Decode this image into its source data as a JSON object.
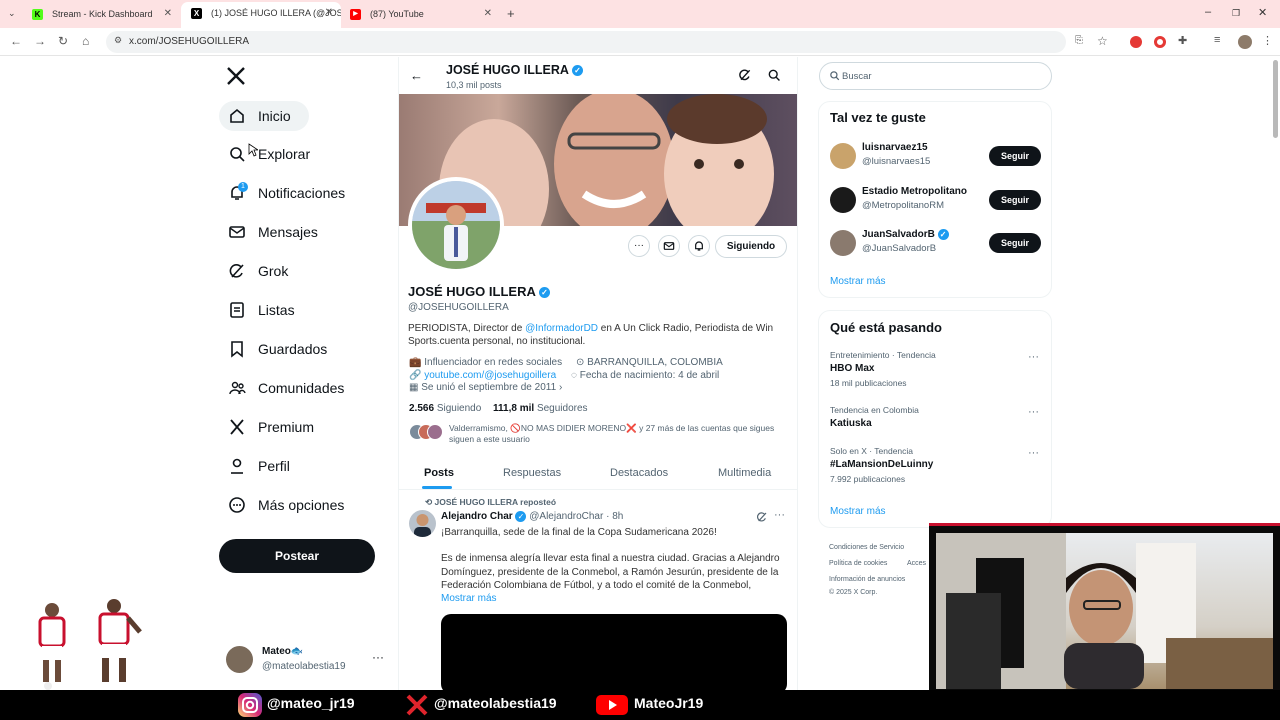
{
  "browser": {
    "tabs": [
      {
        "title": "Stream - Kick Dashboard",
        "favicon": "K"
      },
      {
        "title": "(1) JOSÉ HUGO ILLERA (@JOSE",
        "favicon": "X"
      },
      {
        "title": "(87) YouTube",
        "favicon": "▶"
      }
    ],
    "url": "x.com/JOSEHUGOILLERA"
  },
  "sidebar": {
    "items": [
      {
        "label": "Inicio",
        "icon": "home-icon"
      },
      {
        "label": "Explorar",
        "icon": "search-icon"
      },
      {
        "label": "Notificaciones",
        "icon": "bell-icon",
        "badge": "1"
      },
      {
        "label": "Mensajes",
        "icon": "mail-icon"
      },
      {
        "label": "Grok",
        "icon": "grok-icon"
      },
      {
        "label": "Listas",
        "icon": "list-icon"
      },
      {
        "label": "Guardados",
        "icon": "bookmark-icon"
      },
      {
        "label": "Comunidades",
        "icon": "communities-icon"
      },
      {
        "label": "Premium",
        "icon": "x-logo-icon"
      },
      {
        "label": "Perfil",
        "icon": "person-icon"
      },
      {
        "label": "Más opciones",
        "icon": "more-circle-icon"
      }
    ],
    "post_button": "Postear",
    "account": {
      "name": "Mateo🐟",
      "handle": "@mateolabestia19"
    }
  },
  "profile": {
    "header_name": "JOSÉ HUGO ILLERA",
    "post_count": "10,3 mil posts",
    "name": "JOSÉ HUGO ILLERA",
    "handle": "@JOSEHUGOILLERA",
    "bio_pre": "PERIODISTA, Director de ",
    "bio_link": "@InformadorDD",
    "bio_post": " en A Un Click Radio, Periodista de Win Sports.cuenta personal, no institucional.",
    "category": "Influenciador en redes sociales",
    "location": "BARRANQUILLA, COLOMBIA",
    "website": "youtube.com/@josehugoillera",
    "birth": "Fecha de nacimiento: 4 de abril",
    "joined": "Se unió el septiembre de 2011",
    "following_count": "2.566",
    "following_label": "Siguiendo",
    "followers_count": "111,8 mil",
    "followers_label": "Seguidores",
    "followed_by": "Valderramismo, 🚫NO MAS DIDIER MORENO❌ y 27 más de las cuentas que sigues siguen a este usuario",
    "following_button": "Siguiendo",
    "tabs": [
      "Posts",
      "Respuestas",
      "Destacados",
      "Multimedia"
    ]
  },
  "post": {
    "repost_label": "JOSÉ HUGO ILLERA reposteó",
    "author": "Alejandro Char",
    "handle": "@AlejandroChar",
    "time": "· 8h",
    "line1": "¡Barranquilla, sede de la final de la Copa Sudamericana 2026!",
    "body": "Es de inmensa alegría llevar esta final a nuestra ciudad. Gracias a Alejandro Domínguez, presidente de la Conmebol, a Ramón Jesurún, presidente de la Federación Colombiana de Fútbol, y a todo el comité de la Conmebol,",
    "show_more": "Mostrar más"
  },
  "right": {
    "search_placeholder": "Buscar",
    "suggest_title": "Tal vez te guste",
    "suggestions": [
      {
        "name": "luisnarvaez15",
        "handle": "@luisnarvaes15",
        "button": "Seguir"
      },
      {
        "name": "Estadio Metropolitano",
        "handle": "@MetropolitanoRM",
        "button": "Seguir"
      },
      {
        "name": "JuanSalvadorB",
        "handle": "@JuanSalvadorB",
        "button": "Seguir"
      }
    ],
    "show_more": "Mostrar más",
    "trends_title": "Qué está pasando",
    "trends": [
      {
        "context": "Entretenimiento · Tendencia",
        "name": "HBO Max",
        "count": "18 mil publicaciones"
      },
      {
        "context": "Tendencia en Colombia",
        "name": "Katiuska",
        "count": ""
      },
      {
        "context": "Solo en X · Tendencia",
        "name": "#LaMansionDeLuinny",
        "count": "7.992 publicaciones"
      }
    ],
    "trends_more": "Mostrar más",
    "footer": {
      "l1": "Condiciones de Servicio",
      "l2": "Política de cookies",
      "l2b": "Acces",
      "l3": "Información de anuncios",
      "l4": "© 2025 X Corp."
    }
  },
  "overlay": {
    "instagram": "@mateo_jr19",
    "x": "@mateolabestia19",
    "youtube": "MateoJr19"
  },
  "colors": {
    "accent": "#1d9bf0",
    "text": "#0f1419",
    "muted": "#536471",
    "tabstrip": "#fde2e3"
  }
}
